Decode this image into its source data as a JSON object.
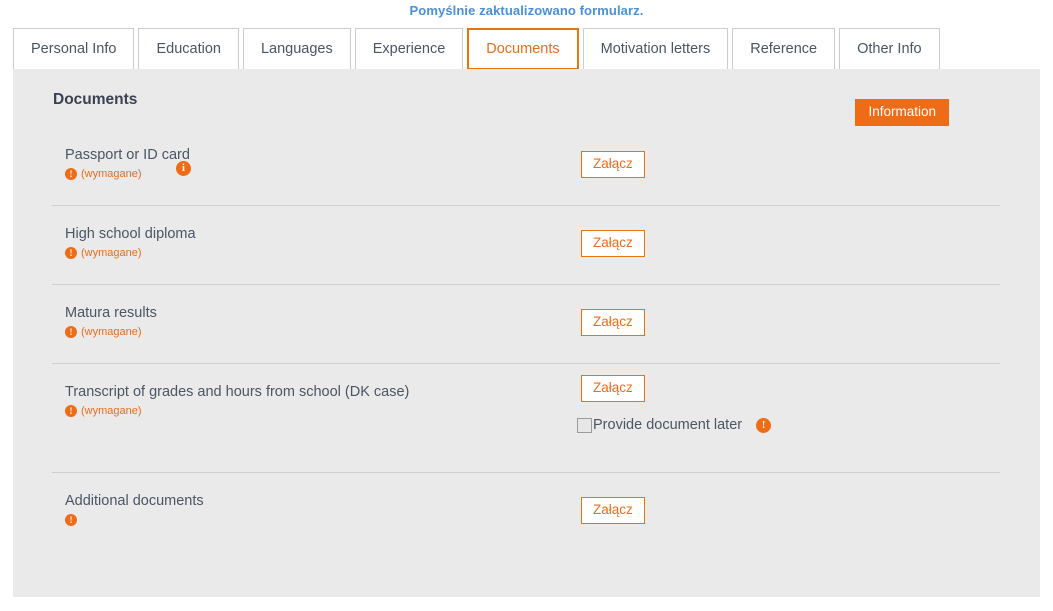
{
  "flash": {
    "message": "Pomyślnie zaktualizowano formularz.",
    "color": "#4a90d9"
  },
  "tabs": [
    {
      "label": "Personal Info",
      "active": false
    },
    {
      "label": "Education",
      "active": false
    },
    {
      "label": "Languages",
      "active": false
    },
    {
      "label": "Experience",
      "active": false
    },
    {
      "label": "Documents",
      "active": true
    },
    {
      "label": "Motivation letters",
      "active": false
    },
    {
      "label": "Reference",
      "active": false
    },
    {
      "label": "Other Info",
      "active": false
    }
  ],
  "panel": {
    "title": "Documents",
    "title_info_icon": "i",
    "information_button": "Information",
    "accent_color": "#ef6c17",
    "background_color": "#eaeaea"
  },
  "rows": [
    {
      "label": "Passport or ID card",
      "required_icon": "!",
      "required_text": "(wymagane)",
      "attach_label": "Załącz"
    },
    {
      "label": "High school diploma",
      "required_icon": "!",
      "required_text": "(wymagane)",
      "attach_label": "Załącz"
    },
    {
      "label": "Matura results",
      "required_icon": "!",
      "required_text": "(wymagane)",
      "attach_label": "Załącz"
    },
    {
      "label": "Transcript of grades and hours from school (DK case)",
      "required_icon": "!",
      "required_text": "(wymagane)",
      "attach_label": "Załącz",
      "checkbox_label": "Provide document later",
      "checkbox_info_icon": "!",
      "checkbox_checked": false
    },
    {
      "label": "Additional documents",
      "required_icon": "!",
      "required_text": "",
      "attach_label": "Załącz"
    }
  ]
}
